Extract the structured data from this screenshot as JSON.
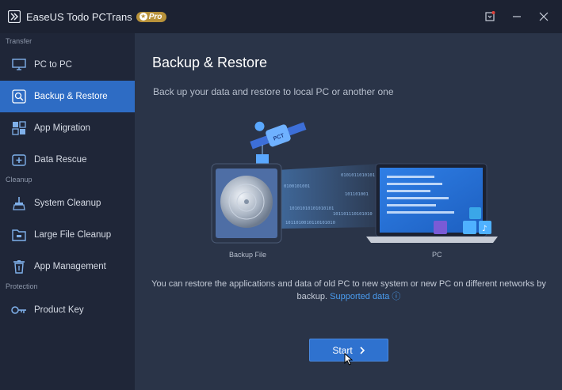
{
  "app": {
    "title": "EaseUS Todo PCTrans",
    "badge": "Pro"
  },
  "sidebar": {
    "sections": [
      {
        "label": "Transfer"
      },
      {
        "label": "Cleanup"
      },
      {
        "label": "Protection"
      }
    ],
    "items": [
      {
        "label": "PC to PC",
        "icon": "monitor-icon"
      },
      {
        "label": "Backup & Restore",
        "icon": "backup-restore-icon",
        "active": true
      },
      {
        "label": "App Migration",
        "icon": "app-migration-icon"
      },
      {
        "label": "Data Rescue",
        "icon": "data-rescue-icon"
      },
      {
        "label": "System Cleanup",
        "icon": "broom-icon"
      },
      {
        "label": "Large File Cleanup",
        "icon": "folder-icon"
      },
      {
        "label": "App Management",
        "icon": "trash-icon"
      },
      {
        "label": "Product Key",
        "icon": "key-icon"
      }
    ]
  },
  "main": {
    "title": "Backup & Restore",
    "subtitle": "Back up your data and restore to local PC or another one",
    "illustration": {
      "left_label": "Backup File",
      "right_label": "PC",
      "satellite_text": "PCT",
      "binary_lines": [
        "0101011010101",
        "0100101001",
        "101101001",
        "10101010101010101",
        "101101110101010",
        "1011010010110101010"
      ]
    },
    "description": "You can restore the applications and data of old PC to new system or new PC on different networks by backup.",
    "link": "Supported data ⓘ",
    "start_button": "Start"
  },
  "colors": {
    "accent": "#2e6cc4",
    "link": "#4a9cf0",
    "badge": "#b8923a"
  }
}
